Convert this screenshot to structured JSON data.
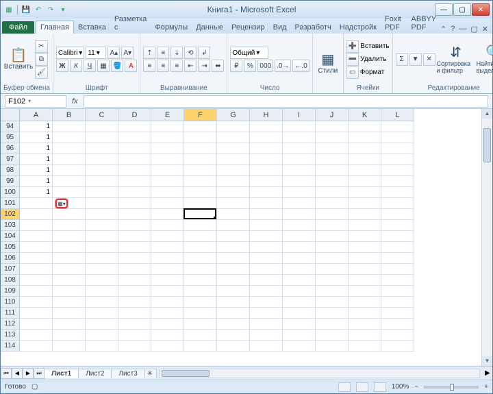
{
  "titlebar": {
    "title": "Книга1 - Microsoft Excel"
  },
  "tabs": {
    "file": "Файл",
    "items": [
      "Главная",
      "Вставка",
      "Разметка с",
      "Формулы",
      "Данные",
      "Рецензир",
      "Вид",
      "Разработч",
      "Надстройк",
      "Foxit PDF",
      "ABBYY PDF"
    ],
    "active_index": 0
  },
  "ribbon": {
    "clipboard": {
      "paste": "Вставить",
      "label": "Буфер обмена"
    },
    "font": {
      "name": "Calibri",
      "size": "11",
      "label": "Шрифт",
      "bold": "Ж",
      "italic": "К",
      "underline": "Ч"
    },
    "align": {
      "label": "Выравнивание"
    },
    "number": {
      "format": "Общий",
      "label": "Число",
      "percent": "%",
      "thousands": "000"
    },
    "styles": {
      "label": "Стили",
      "btn": "Стили"
    },
    "cells": {
      "insert": "Вставить",
      "delete": "Удалить",
      "format": "Формат",
      "label": "Ячейки"
    },
    "editing": {
      "sort": "Сортировка и фильтр",
      "find": "Найти и выделить",
      "label": "Редактирование"
    }
  },
  "formula_bar": {
    "name_box": "F102",
    "fx": "fx",
    "value": ""
  },
  "grid": {
    "columns": [
      "A",
      "B",
      "C",
      "D",
      "E",
      "F",
      "G",
      "H",
      "I",
      "J",
      "K",
      "L"
    ],
    "active_col_index": 5,
    "row_start": 94,
    "row_end": 114,
    "active_row": 102,
    "data": {
      "A": {
        "94": "1",
        "95": "1",
        "96": "1",
        "97": "1",
        "98": "1",
        "99": "1",
        "100": "1"
      }
    },
    "selection": {
      "col": "F",
      "row": 102
    },
    "autofill_marker": {
      "col": "B",
      "row": 101
    }
  },
  "sheets": {
    "items": [
      "Лист1",
      "Лист2",
      "Лист3"
    ],
    "active_index": 0
  },
  "status": {
    "ready": "Готово",
    "zoom": "100%",
    "minus": "−",
    "plus": "+"
  }
}
